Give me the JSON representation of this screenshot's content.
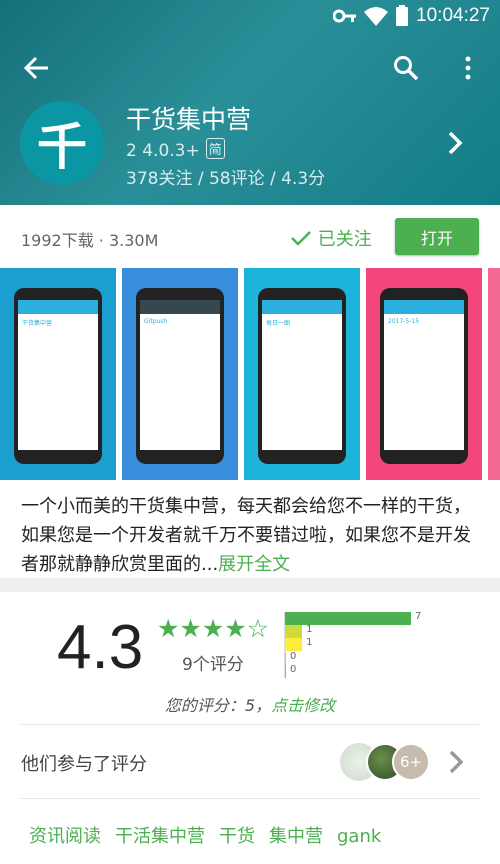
{
  "status": {
    "time": "10:04:27"
  },
  "app": {
    "icon_char": "千",
    "name": "干货集中营",
    "version": "2  4.0.3+",
    "lang_badge": "简",
    "stats": "378关注 / 58评论 / 4.3分"
  },
  "download": {
    "info": "1992下载 · 3.30M",
    "follow_label": "已关注",
    "open_label": "打开"
  },
  "screenshots": [
    {
      "color": "#1a9fd0",
      "header": "#2bb0dd",
      "caption": "干货集中营"
    },
    {
      "color": "#3a8fdc",
      "header": "#37474f",
      "caption": "Gitpush"
    },
    {
      "color": "#1eb3d8",
      "header": "#2bb0dd",
      "caption": "每日一图"
    },
    {
      "color": "#f1457b",
      "header": "#2bb0dd",
      "caption": "2017-5-15"
    },
    {
      "color": "#f56a95",
      "header": "#fff",
      "caption": ""
    }
  ],
  "description": {
    "text": "一个小而美的干货集中营，每天都会给您不一样的干货，如果您是一个开发者就千万不要错过啦，如果您不是开发者那就静静欣赏里面的...",
    "more": "展开全文"
  },
  "rating": {
    "score": "4.3",
    "stars": 4.3,
    "count_label": "9个评分",
    "histogram": [
      {
        "stars": 5,
        "count": "7",
        "color": "#4caf50"
      },
      {
        "stars": 4,
        "count": "1",
        "color": "#cddc39"
      },
      {
        "stars": 3,
        "count": "1",
        "color": "#ffeb3b"
      },
      {
        "stars": 2,
        "count": "0",
        "color": "#ffb74d"
      },
      {
        "stars": 1,
        "count": "0",
        "color": "#ff8a65"
      }
    ],
    "yours_prefix": "您的评分：5，",
    "yours_edit": "点击修改"
  },
  "participants": {
    "label": "他们参与了评分",
    "more_count": "6+"
  },
  "tags": [
    "资讯阅读",
    "干活集中营",
    "干货",
    "集中营",
    "gank"
  ]
}
